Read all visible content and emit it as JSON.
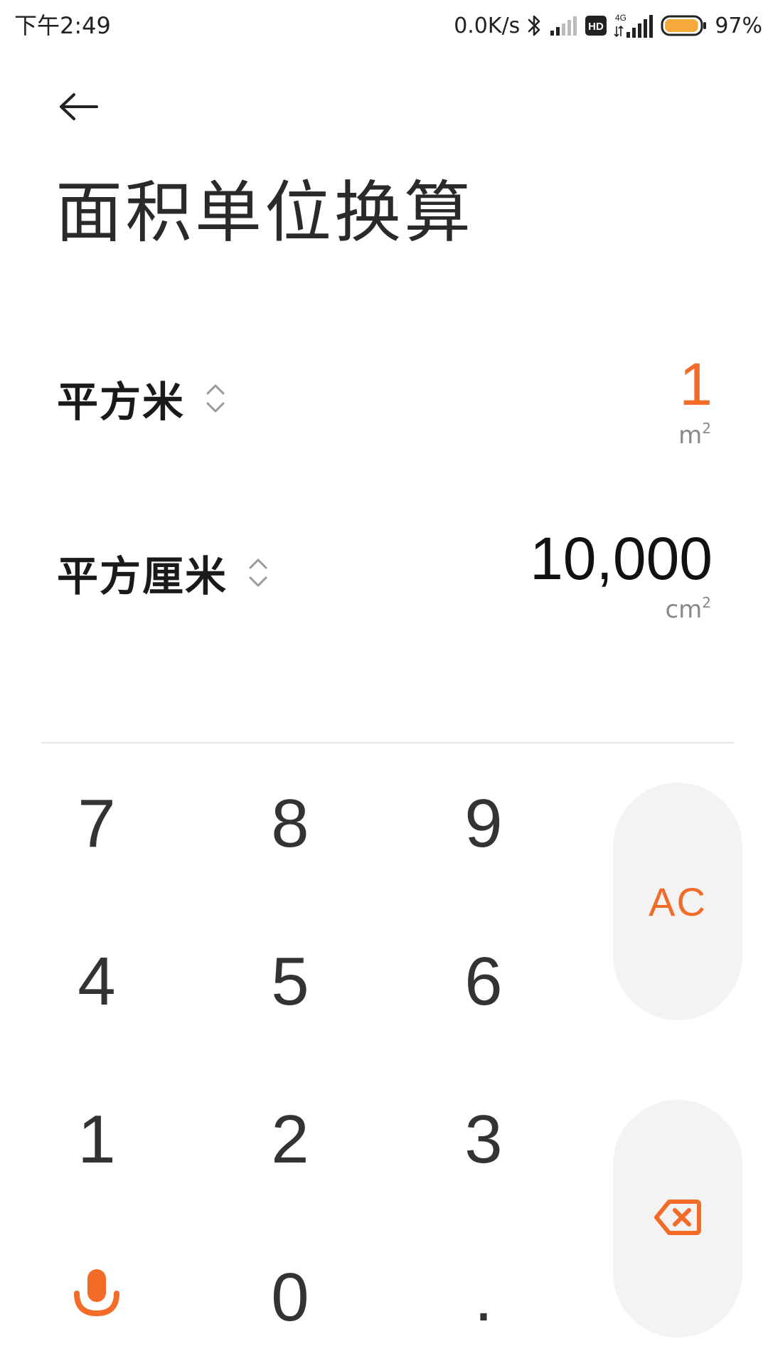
{
  "status_bar": {
    "time": "下午2:49",
    "network_speed": "0.0K/s",
    "network_type": "4G",
    "hd_badge": "HD",
    "battery_percent": "97%",
    "battery_level": 0.97,
    "icons": [
      "bluetooth-icon",
      "signal-icon",
      "hd-icon",
      "4g-signal-icon",
      "battery-icon"
    ]
  },
  "header": {
    "back_icon": "arrow-left-icon",
    "title": "面积单位换算"
  },
  "units": [
    {
      "name": "平方米",
      "value": "1",
      "symbol": "m",
      "symbol_exp": "2",
      "active": true
    },
    {
      "name": "平方厘米",
      "value": "10,000",
      "symbol": "cm",
      "symbol_exp": "2",
      "active": false
    }
  ],
  "keypad": {
    "keys": [
      "7",
      "8",
      "9",
      "4",
      "5",
      "6",
      "1",
      "2",
      "3",
      "0",
      "."
    ],
    "clear_label": "AC",
    "mic_icon": "microphone-icon",
    "backspace_icon": "backspace-icon"
  },
  "colors": {
    "accent": "#f26b27",
    "text_primary": "#1a1a1a",
    "text_secondary": "#888888",
    "key_background": "#f3f3f3",
    "divider": "#e6e6e6"
  }
}
